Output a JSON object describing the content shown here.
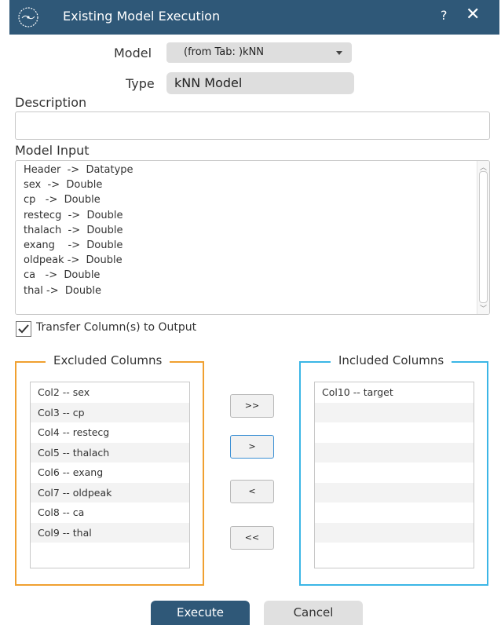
{
  "window": {
    "title": "Existing Model Execution",
    "help_label": "?",
    "close_label": "✕"
  },
  "form": {
    "model_label": "Model",
    "model_value": "(from Tab: )kNN",
    "type_label": "Type",
    "type_value": "kNN Model",
    "description_label": "Description",
    "description_value": "",
    "model_input_label": "Model Input",
    "model_input_lines": [
      "Header  ->  Datatype",
      "sex  ->  Double",
      "cp   ->  Double",
      "restecg  ->  Double",
      "thalach  ->  Double",
      "exang    ->  Double",
      "oldpeak ->  Double",
      "ca   ->  Double",
      "thal ->  Double"
    ],
    "transfer_label": "Transfer Column(s) to Output",
    "transfer_checked": true
  },
  "excluded": {
    "title": "Excluded Columns",
    "items": [
      "Col2 -- sex",
      "Col3 -- cp",
      "Col4 -- restecg",
      "Col5 -- thalach",
      "Col6 -- exang",
      "Col7 -- oldpeak",
      "Col8 -- ca",
      "Col9 -- thal"
    ]
  },
  "included": {
    "title": "Included Columns",
    "items": [
      "Col10 -- target"
    ]
  },
  "move_buttons": {
    "add_all": ">>",
    "add": ">",
    "remove": "<",
    "remove_all": "<<"
  },
  "actions": {
    "execute": "Execute",
    "cancel": "Cancel"
  },
  "colors": {
    "titlebar": "#2f5878",
    "excluded_border": "#f0a030",
    "included_border": "#3bb6e6"
  }
}
